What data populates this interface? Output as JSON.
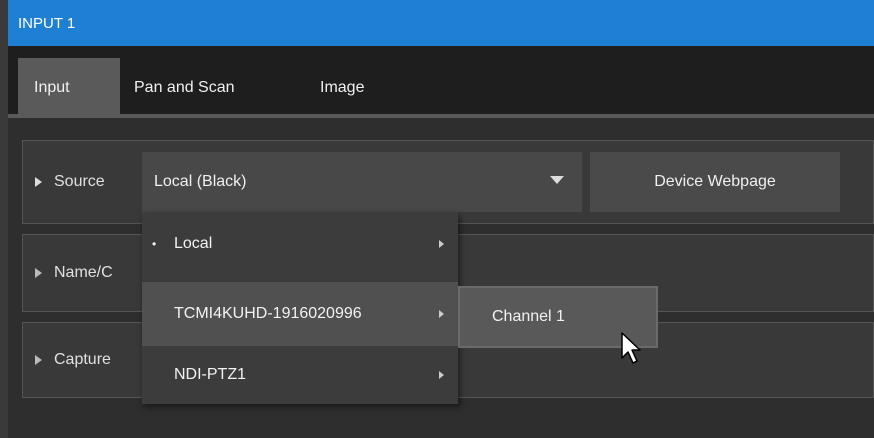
{
  "window": {
    "title": "INPUT 1"
  },
  "tabs": [
    {
      "label": "Input",
      "active": true
    },
    {
      "label": "Pan and Scan",
      "active": false
    },
    {
      "label": "Image",
      "active": false
    }
  ],
  "rows": {
    "source_label": "Source",
    "name_label": "Name/C",
    "capture_label": "Capture"
  },
  "source_select": {
    "value": "Local (Black)"
  },
  "device_webpage_button": "Device Webpage",
  "menu": {
    "items": [
      {
        "label": "Local",
        "selected": true,
        "has_submenu": true
      },
      {
        "label": "TCMI4KUHD-1916020996",
        "selected": false,
        "has_submenu": true,
        "hover": true
      },
      {
        "label": "NDI-PTZ1",
        "selected": false,
        "has_submenu": true
      }
    ],
    "selected_bullet": "•"
  },
  "submenu": {
    "items": [
      {
        "label": "Channel 1"
      }
    ]
  },
  "colors": {
    "titlebar": "#1f7fd3",
    "panel": "#393939",
    "menu": "#3c3c3c"
  }
}
